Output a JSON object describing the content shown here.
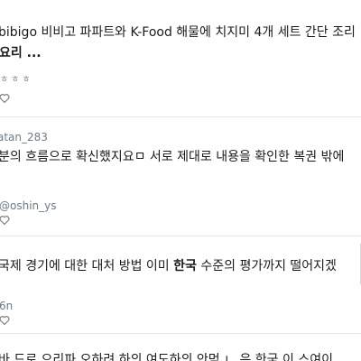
{
  "posts": [
    {
      "line1": "bibigo 비비고 파파트와 K-Food 해물에 치지미 4개 세트 간단 조리",
      "line2": "요리 ...",
      "dots": "ㅎㅎㅎ"
    },
    {
      "author": "atan_283",
      "text": "분의 흐름으로 확신했지요ㅁ 서로 제대로 내용을 확인한 복권 밖에",
      "mention": "@oshin_ys"
    },
    {
      "text_before": "국제 경기에 대한 대처 방법 이미 ",
      "text_highlight": "한국",
      "text_after": " 수준의 평가까지 떨어지겠",
      "author": "6n"
    },
    {
      "text": "바 드로 으리파 오하려 하의 여도하의 안먹 ㄴ 은 한국 이 스여이"
    }
  ]
}
